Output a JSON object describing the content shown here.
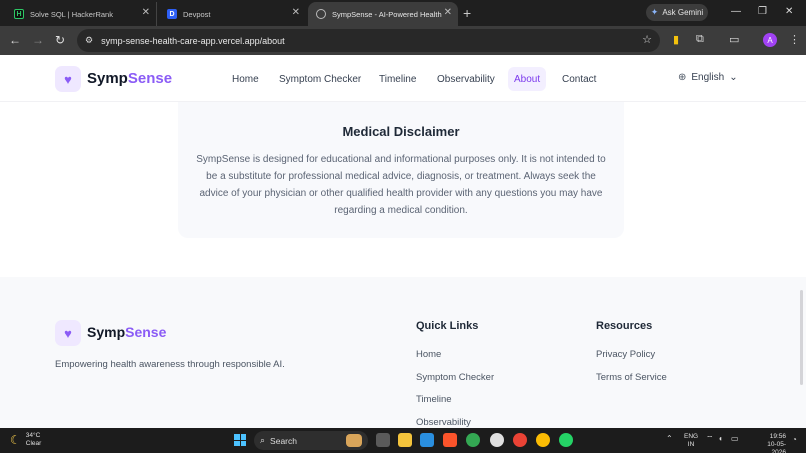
{
  "browser": {
    "tabs": [
      {
        "label": "Solve SQL | HackerRank",
        "favicon": "hackerrank-icon"
      },
      {
        "label": "Devpost",
        "favicon": "devpost-icon"
      },
      {
        "label": "SympSense - AI-Powered Healthcare",
        "favicon": "globe-icon"
      }
    ],
    "ask_gemini": "Ask Gemini",
    "url": "symp-sense-health-care-app.vercel.app/about"
  },
  "site": {
    "brand_prefix": "Symp",
    "brand_suffix": "Sense",
    "nav": [
      "Home",
      "Symptom Checker",
      "Timeline",
      "Observability",
      "About",
      "Contact"
    ],
    "active_nav": "About",
    "language": "English"
  },
  "disclaimer": {
    "title": "Medical Disclaimer",
    "body": "SympSense is designed for educational and informational purposes only. It is not intended to be a substitute for professional medical advice, diagnosis, or treatment. Always seek the advice of your physician or other qualified health provider with any questions you may have regarding a medical condition."
  },
  "footer": {
    "tagline": "Empowering health awareness through responsible AI.",
    "quick_links_title": "Quick Links",
    "quick_links": [
      "Home",
      "Symptom Checker",
      "Timeline",
      "Observability"
    ],
    "resources_title": "Resources",
    "resources": [
      "Privacy Policy",
      "Terms of Service"
    ]
  },
  "taskbar": {
    "temperature": "34°C",
    "condition": "Clear",
    "search": "Search",
    "lang_line1": "ENG",
    "lang_line2": "IN",
    "time": "19:56",
    "date": "10-05-2026"
  },
  "colors": {
    "accent": "#8b5cf6",
    "accent_bg": "#f3efff",
    "chrome_dark": "#1f1f1f",
    "footer_bg": "#f8f9fb"
  }
}
